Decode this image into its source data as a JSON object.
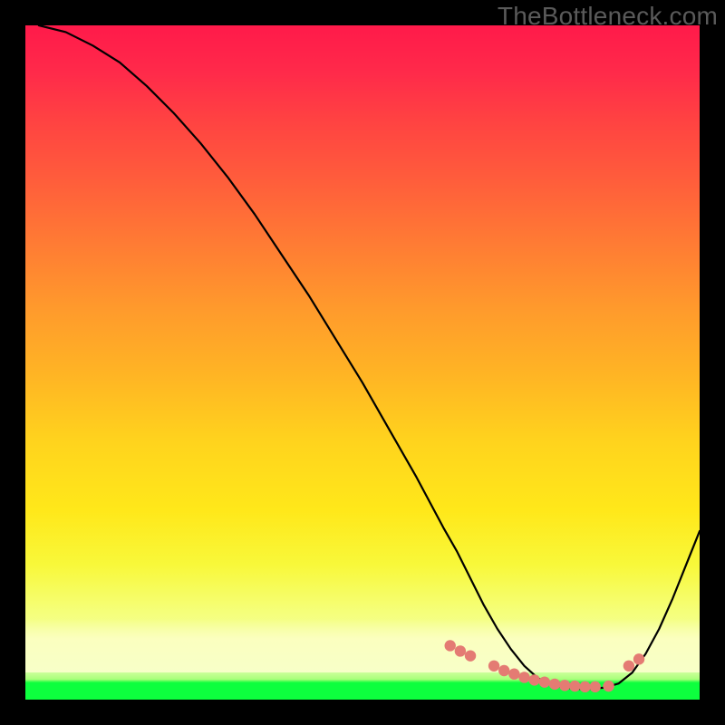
{
  "watermark": "TheBottleneck.com",
  "chart_data": {
    "type": "line",
    "title": "",
    "xlabel": "",
    "ylabel": "",
    "xlim": [
      0,
      100
    ],
    "ylim": [
      0,
      100
    ],
    "grid": false,
    "legend": false,
    "series": [
      {
        "name": "bottleneck-curve",
        "x": [
          2,
          6,
          10,
          14,
          18,
          22,
          26,
          30,
          34,
          38,
          42,
          46,
          50,
          54,
          58,
          62,
          64,
          66,
          68,
          70,
          72,
          74,
          76,
          78,
          80,
          82,
          84,
          86,
          88,
          90,
          92,
          94,
          96,
          98,
          100
        ],
        "values": [
          100,
          99,
          97,
          94.5,
          91,
          87,
          82.5,
          77.5,
          72,
          66,
          60,
          53.5,
          47,
          40,
          33,
          25.5,
          22,
          18,
          14,
          10.5,
          7.5,
          5,
          3.2,
          2.2,
          1.8,
          1.6,
          1.6,
          1.8,
          2.4,
          4,
          6.8,
          10.5,
          15,
          20,
          25
        ]
      }
    ],
    "marker_band": {
      "name": "optimal-range-dots",
      "color": "#e47b73",
      "x": [
        63,
        64.5,
        66,
        69.5,
        71,
        72.5,
        74,
        75.5,
        77,
        78.5,
        80,
        81.5,
        83,
        84.5,
        86.5,
        89.5,
        91
      ],
      "values": [
        8.0,
        7.2,
        6.5,
        5.0,
        4.3,
        3.8,
        3.3,
        2.9,
        2.6,
        2.3,
        2.1,
        2.0,
        1.9,
        1.9,
        2.0,
        5.0,
        6.0
      ]
    },
    "background_gradient_stops": [
      {
        "pos": 0.0,
        "color": "#ff1a4a"
      },
      {
        "pos": 0.4,
        "color": "#ff9a2c"
      },
      {
        "pos": 0.7,
        "color": "#ffe81a"
      },
      {
        "pos": 0.9,
        "color": "#f5ff7a"
      },
      {
        "pos": 0.97,
        "color": "#ecffb8"
      },
      {
        "pos": 1.0,
        "color": "#0dff3e"
      }
    ]
  }
}
